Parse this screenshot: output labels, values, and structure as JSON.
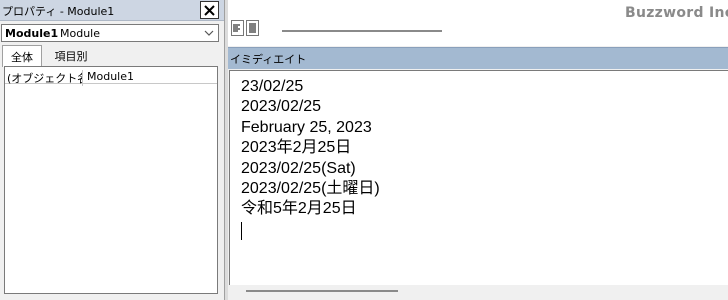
{
  "properties": {
    "title": "プロパティ - Module1",
    "object_name": "Module1",
    "object_type": "Module",
    "tabs": [
      {
        "label": "全体"
      },
      {
        "label": "項目別"
      }
    ],
    "rows": [
      {
        "name": "(オブジェクト名)",
        "value": "Module1"
      }
    ]
  },
  "watermark": "Buzzword Inc.",
  "immediate": {
    "title": "イミディエイト",
    "lines": [
      "23/02/25",
      "2023/02/25",
      "February 25, 2023",
      "2023年2月25日",
      "2023/02/25(Sat)",
      "2023/02/25(土曜日)",
      "令和5年2月25日"
    ]
  },
  "icons": {
    "close": "close-icon",
    "chevron": "chevron-down-icon",
    "procedure_view": "procedure-view-icon",
    "full_module_view": "full-module-view-icon"
  }
}
